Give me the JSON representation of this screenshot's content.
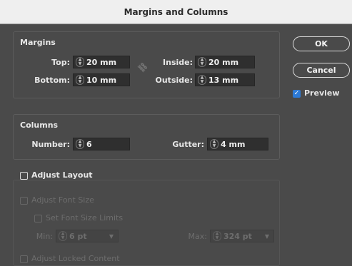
{
  "dialog": {
    "title": "Margins and Columns"
  },
  "margins": {
    "title": "Margins",
    "top_label": "Top:",
    "top_value": "20 mm",
    "bottom_label": "Bottom:",
    "bottom_value": "10 mm",
    "inside_label": "Inside:",
    "inside_value": "20 mm",
    "outside_label": "Outside:",
    "outside_value": "13 mm",
    "link_icon": "chain-link-icon"
  },
  "columns": {
    "title": "Columns",
    "number_label": "Number:",
    "number_value": "6",
    "gutter_label": "Gutter:",
    "gutter_value": "4 mm"
  },
  "adjust": {
    "layout_label": "Adjust Layout",
    "font_size_label": "Adjust Font Size",
    "font_limits_label": "Set Font Size Limits",
    "min_label": "Min:",
    "min_value": "6 pt",
    "max_label": "Max:",
    "max_value": "324 pt",
    "locked_label": "Adjust Locked Content"
  },
  "buttons": {
    "ok": "OK",
    "cancel": "Cancel",
    "preview_label": "Preview"
  },
  "colors": {
    "accent": "#2d7ad6",
    "panel": "#4a4a4a",
    "titlebar": "#efefef"
  }
}
